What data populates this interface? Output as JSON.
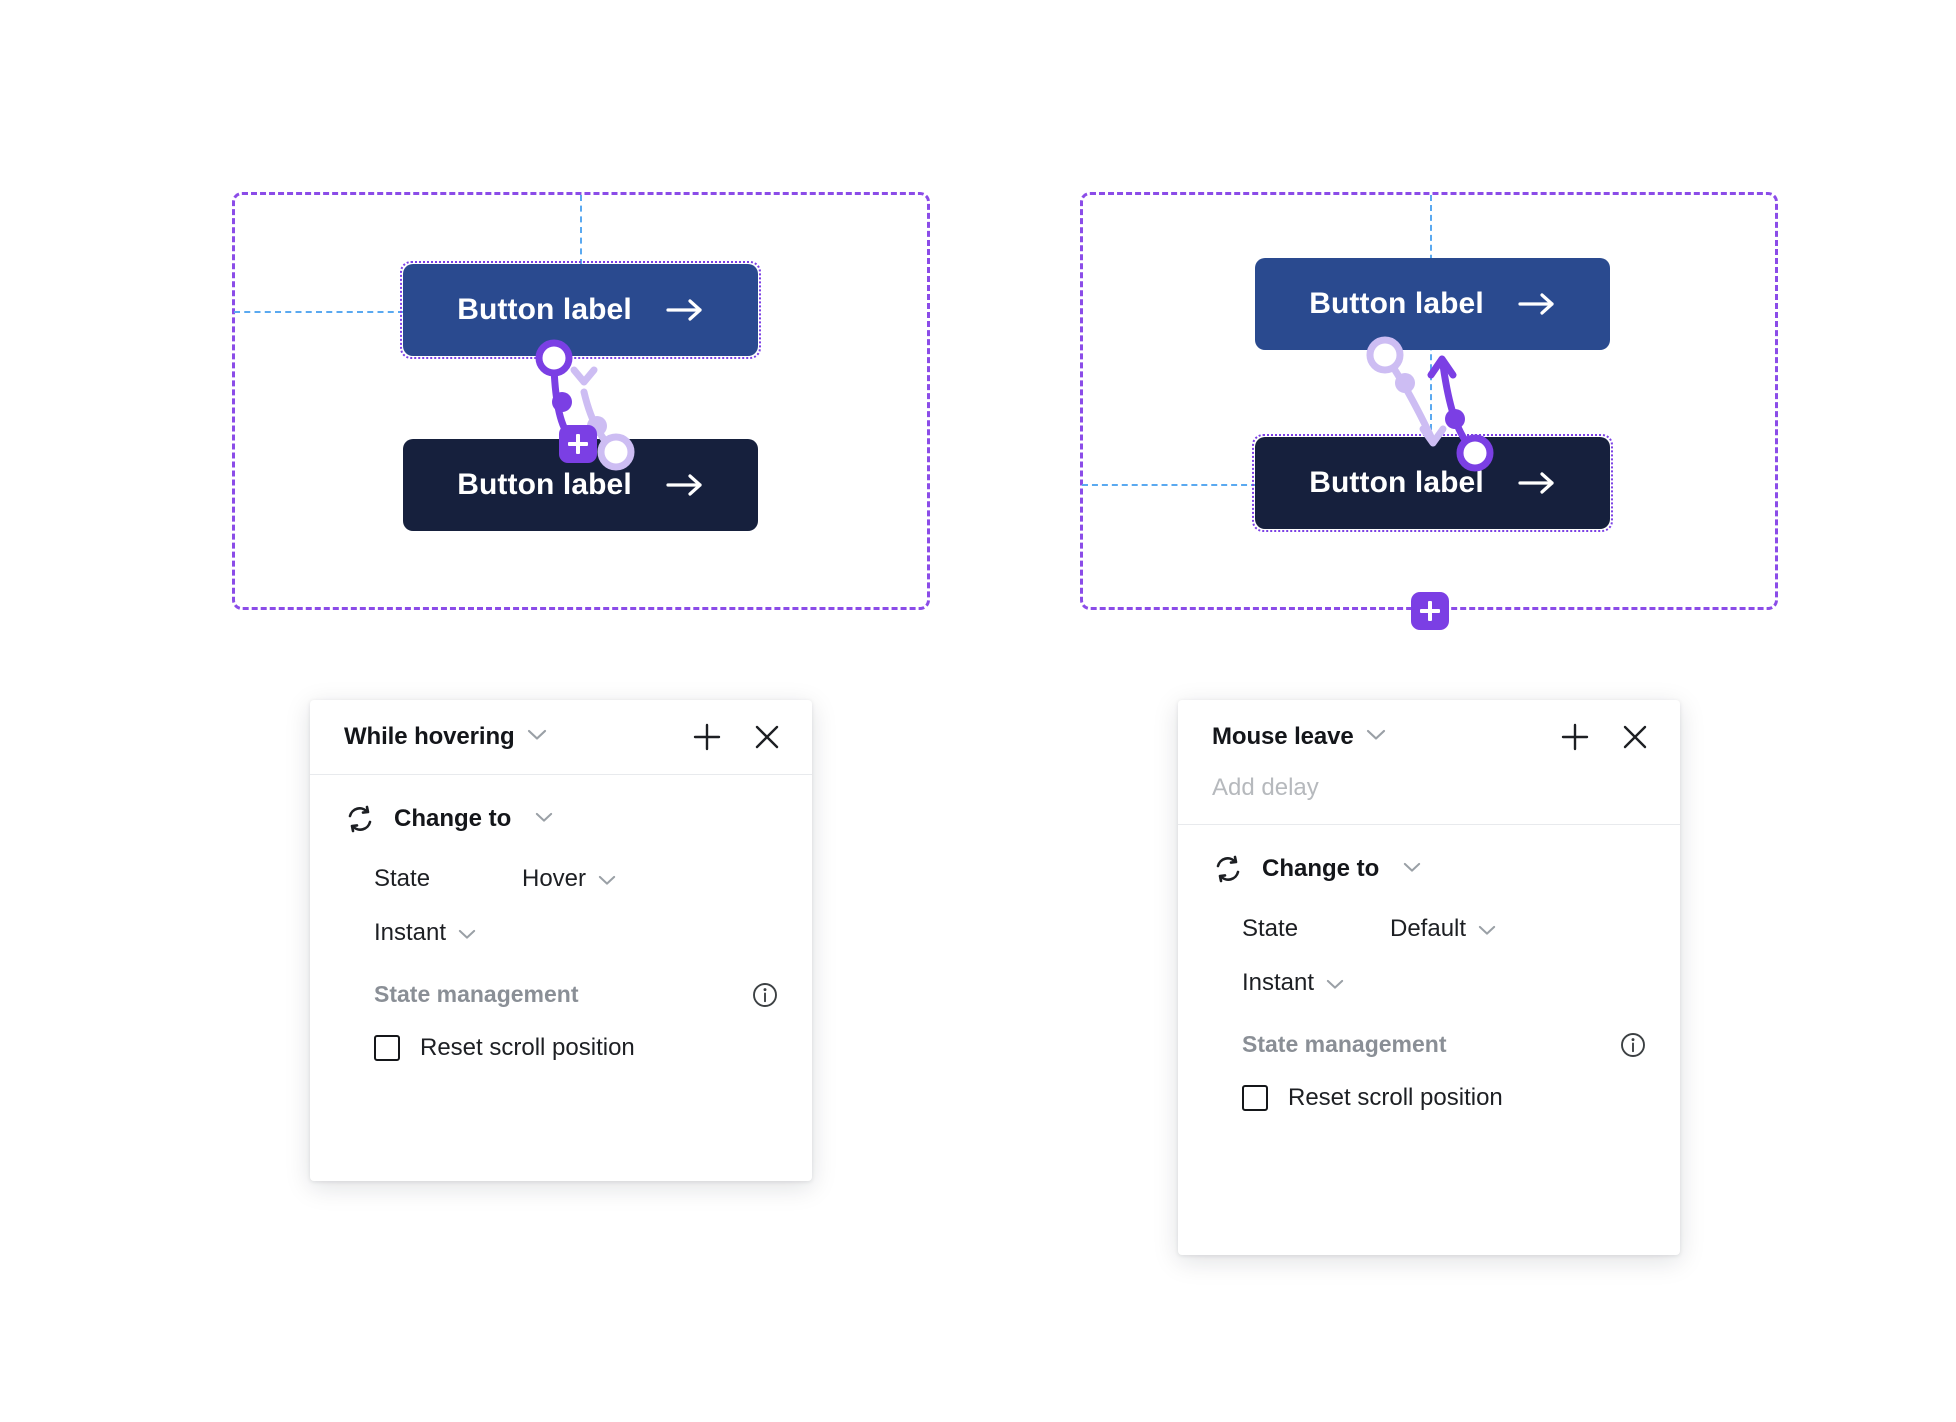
{
  "canvas": {
    "frames": [
      {
        "name": "left-frame",
        "buttons": [
          {
            "label": "Button label",
            "state": "Default",
            "selected": true
          },
          {
            "label": "Button label",
            "state": "Hover",
            "selected": false
          }
        ]
      },
      {
        "name": "right-frame",
        "buttons": [
          {
            "label": "Button label",
            "state": "Default",
            "selected": false
          },
          {
            "label": "Button label",
            "state": "Hover",
            "selected": true
          }
        ]
      }
    ],
    "add_badge_label": "+",
    "colors": {
      "frame_outline": "#8b4ce8",
      "alignment_guide": "#5aa9f0",
      "button_default": "#2a4a8f",
      "button_hover": "#16203d",
      "connector_accent": "#7b3fe4",
      "connector_ghost": "#cdbdf3"
    }
  },
  "panels": [
    {
      "id": "while-hovering",
      "title": "While hovering",
      "has_delay_field": false,
      "delay_placeholder": "",
      "add_label": "+",
      "close_label": "×",
      "section": {
        "title": "Change to",
        "icon": "sync-icon",
        "state_label": "State",
        "state_value": "Hover",
        "timing_value": "Instant"
      },
      "state_management": {
        "title": "State management",
        "info_label": "i",
        "checkbox_label": "Reset scroll position",
        "checked": false
      }
    },
    {
      "id": "mouse-leave",
      "title": "Mouse leave",
      "has_delay_field": true,
      "delay_placeholder": "Add delay",
      "add_label": "+",
      "close_label": "×",
      "section": {
        "title": "Change to",
        "icon": "sync-icon",
        "state_label": "State",
        "state_value": "Default",
        "timing_value": "Instant"
      },
      "state_management": {
        "title": "State management",
        "info_label": "i",
        "checkbox_label": "Reset scroll position",
        "checked": false
      }
    }
  ]
}
